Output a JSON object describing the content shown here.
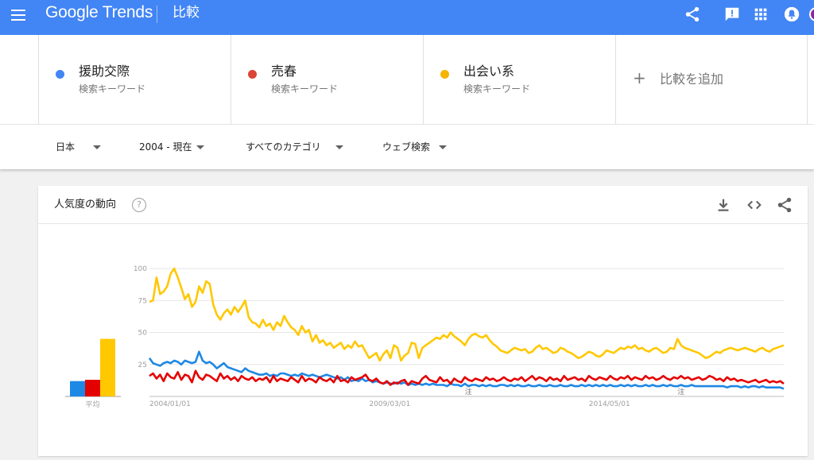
{
  "app": {
    "logo": "Google Trends",
    "page_title": "比較"
  },
  "topbar_icons": [
    "share-icon",
    "feedback-icon",
    "apps-grid-icon",
    "notifications-icon"
  ],
  "terms": [
    {
      "name": "援助交際",
      "sub": "検索キーワード",
      "color": "#4285f4"
    },
    {
      "name": "売春",
      "sub": "検索キーワード",
      "color": "#db4437"
    },
    {
      "name": "出会い系",
      "sub": "検索キーワード",
      "color": "#f4b400"
    }
  ],
  "add_term": {
    "label": "比較を追加"
  },
  "filters": {
    "region": "日本",
    "period": "2004 - 現在",
    "category": "すべてのカテゴリ",
    "search_type": "ウェブ検索"
  },
  "card": {
    "title": "人気度の動向",
    "help_symbol": "?"
  },
  "chart_data": {
    "type": "line",
    "y_ticks": [
      "100",
      "75",
      "50",
      "25"
    ],
    "ylim": [
      0,
      100
    ],
    "x_labels": [
      "2004/01/01",
      "2009/03/01",
      "2014/05/01"
    ],
    "x_label_months": [
      0,
      62,
      124
    ],
    "note_marker": "注",
    "note_months": [
      90,
      150
    ],
    "average_label": "平均",
    "averages": [
      12,
      13,
      45
    ],
    "series_colors": [
      "#1e88e5",
      "#e50000",
      "#ffc800"
    ],
    "series": [
      {
        "values": [
          30,
          26,
          25,
          24,
          26,
          27,
          26,
          28,
          27,
          25,
          28,
          27,
          26,
          27,
          35,
          28,
          26,
          27,
          25,
          22,
          24,
          26,
          23,
          22,
          21,
          20,
          19,
          22,
          20,
          19,
          18,
          17,
          17,
          18,
          16,
          17,
          16,
          18,
          18,
          17,
          16,
          17,
          16,
          18,
          17,
          16,
          17,
          16,
          15,
          16,
          17,
          16,
          15,
          14,
          15,
          13,
          15,
          12,
          13,
          12,
          14,
          12,
          13,
          11,
          12,
          11,
          10,
          11,
          10,
          10,
          11,
          10,
          11,
          9,
          10,
          9,
          10,
          9,
          10,
          9,
          10,
          9,
          9,
          9,
          8,
          10,
          9,
          9,
          8,
          10,
          8,
          9,
          9,
          8,
          9,
          8,
          9,
          8,
          8,
          9,
          9,
          8,
          9,
          8,
          9,
          8,
          8,
          9,
          8,
          8,
          9,
          8,
          8,
          9,
          8,
          8,
          9,
          8,
          8,
          9,
          8,
          8,
          9,
          8,
          9,
          8,
          9,
          8,
          9,
          8,
          9,
          8,
          8,
          9,
          8,
          9,
          8,
          9,
          8,
          8,
          9,
          8,
          9,
          8,
          8,
          9,
          8,
          9,
          8,
          8,
          9,
          8,
          8,
          9,
          8,
          8,
          8,
          8,
          8,
          8,
          8,
          8,
          8,
          7,
          8,
          8,
          8,
          7,
          8,
          7,
          8,
          8,
          7,
          8,
          7,
          7,
          7,
          7,
          7,
          6
        ]
      },
      {
        "values": [
          16,
          18,
          14,
          17,
          12,
          18,
          15,
          14,
          19,
          13,
          17,
          16,
          11,
          20,
          15,
          13,
          17,
          16,
          14,
          12,
          18,
          14,
          16,
          13,
          15,
          12,
          16,
          14,
          13,
          15,
          12,
          14,
          13,
          15,
          11,
          16,
          12,
          14,
          13,
          12,
          15,
          13,
          11,
          16,
          12,
          14,
          13,
          11,
          15,
          13,
          12,
          14,
          11,
          16,
          12,
          13,
          11,
          15,
          13,
          14,
          15,
          17,
          13,
          12,
          14,
          11,
          10,
          12,
          9,
          11,
          10,
          12,
          13,
          9,
          12,
          11,
          10,
          14,
          16,
          13,
          12,
          11,
          15,
          12,
          13,
          10,
          14,
          12,
          11,
          15,
          13,
          12,
          14,
          13,
          12,
          15,
          13,
          14,
          12,
          13,
          15,
          13,
          12,
          14,
          13,
          15,
          12,
          14,
          16,
          13,
          15,
          14,
          12,
          15,
          13,
          14,
          12,
          16,
          13,
          14,
          15,
          13,
          14,
          12,
          16,
          14,
          13,
          15,
          14,
          13,
          16,
          14,
          13,
          15,
          14,
          16,
          13,
          15,
          14,
          13,
          16,
          14,
          15,
          13,
          14,
          16,
          14,
          13,
          15,
          14,
          16,
          14,
          15,
          13,
          14,
          15,
          13,
          14,
          16,
          15,
          13,
          14,
          12,
          15,
          13,
          14,
          12,
          13,
          12,
          11,
          12,
          13,
          11,
          12,
          13,
          11,
          12,
          11,
          12,
          10
        ]
      },
      {
        "values": [
          74,
          75,
          93,
          80,
          82,
          86,
          96,
          100,
          93,
          85,
          76,
          80,
          70,
          74,
          86,
          81,
          90,
          88,
          72,
          64,
          60,
          65,
          68,
          64,
          70,
          66,
          70,
          75,
          62,
          58,
          57,
          54,
          60,
          55,
          57,
          52,
          58,
          55,
          63,
          58,
          54,
          52,
          48,
          55,
          50,
          52,
          43,
          48,
          42,
          44,
          40,
          42,
          38,
          40,
          42,
          37,
          40,
          38,
          43,
          39,
          40,
          35,
          30,
          32,
          34,
          28,
          33,
          36,
          30,
          40,
          38,
          28,
          32,
          34,
          42,
          41,
          30,
          38,
          40,
          42,
          44,
          46,
          45,
          48,
          46,
          50,
          47,
          45,
          43,
          40,
          45,
          48,
          49,
          47,
          46,
          48,
          44,
          41,
          39,
          36,
          35,
          34,
          36,
          38,
          37,
          36,
          37,
          34,
          35,
          38,
          40,
          37,
          38,
          36,
          34,
          35,
          38,
          37,
          35,
          34,
          32,
          30,
          31,
          33,
          35,
          34,
          32,
          31,
          33,
          36,
          35,
          34,
          36,
          38,
          37,
          39,
          38,
          40,
          37,
          38,
          36,
          35,
          37,
          38,
          36,
          34,
          35,
          38,
          37,
          45,
          40,
          38,
          37,
          36,
          35,
          34,
          32,
          30,
          31,
          33,
          35,
          34,
          36,
          37,
          38,
          37,
          36,
          37,
          38,
          37,
          36,
          35,
          37,
          38,
          36,
          35,
          37,
          38,
          39,
          40
        ]
      }
    ]
  }
}
